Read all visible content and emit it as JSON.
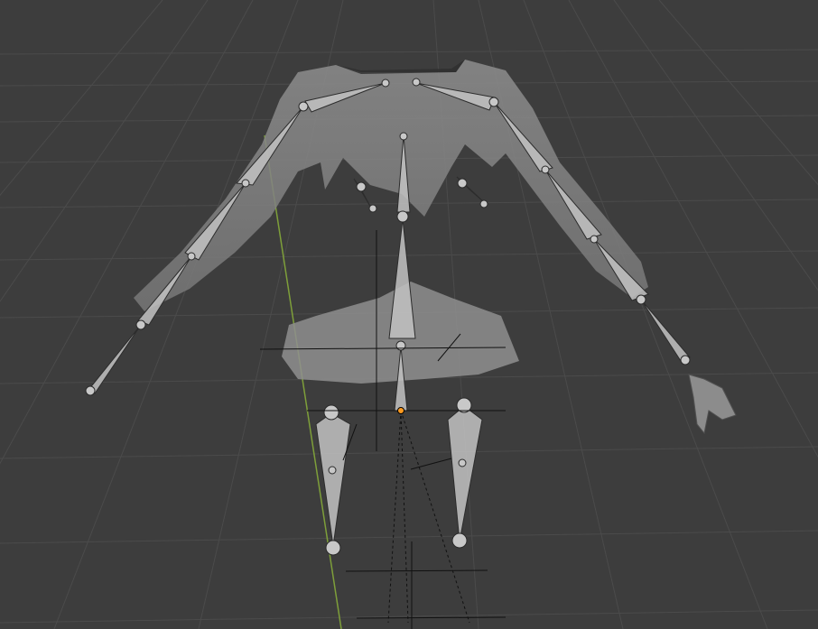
{
  "viewport": {
    "mode": "3d-viewport",
    "shading": "solid",
    "object": "armature-with-clothing-mesh"
  },
  "colors": {
    "background": "#3d3d3d",
    "grid_line": "#4a4a4a",
    "y_axis": "#7e9f3a",
    "mesh": "#8a8a8a",
    "bone_fill": "#bdbdbd",
    "bone_stroke": "#2e2e2e",
    "origin": "#ff9a1e"
  }
}
